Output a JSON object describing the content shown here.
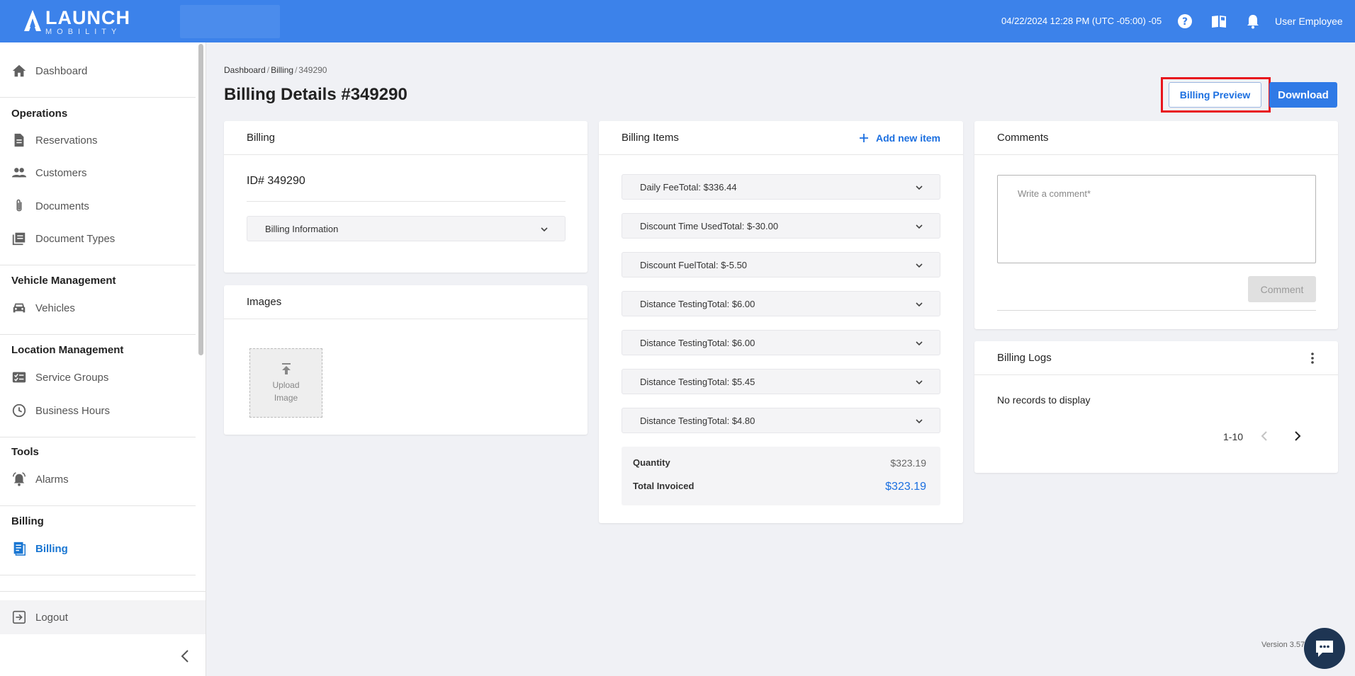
{
  "app": {
    "logo_main": "LAUNCH",
    "logo_sub": "MOBILITY",
    "datetime": "04/22/2024 12:28 PM (UTC -05:00) -05",
    "user": "User Employee"
  },
  "sidebar": {
    "dashboard": "Dashboard",
    "groups": {
      "operations": "Operations",
      "vehicle_management": "Vehicle Management",
      "location_management": "Location Management",
      "tools": "Tools",
      "billing": "Billing"
    },
    "items": {
      "reservations": "Reservations",
      "customers": "Customers",
      "documents": "Documents",
      "document_types": "Document Types",
      "vehicles": "Vehicles",
      "service_groups": "Service Groups",
      "business_hours": "Business Hours",
      "alarms": "Alarms",
      "billing": "Billing"
    },
    "logout": "Logout",
    "active_color": "#1976d2"
  },
  "breadcrumb": [
    "Dashboard",
    "Billing",
    "349290"
  ],
  "page": {
    "title": "Billing Details #349290",
    "preview_button": "Billing Preview",
    "download_button": "Download"
  },
  "billing_card": {
    "title": "Billing",
    "id_text": "ID# 349290",
    "info_label": "Billing Information"
  },
  "images_card": {
    "title": "Images",
    "upload_line1": "Upload",
    "upload_line2": "Image"
  },
  "billing_items": {
    "title": "Billing Items",
    "add_label": "Add new item",
    "items": [
      "Daily FeeTotal: $336.44",
      "Discount Time UsedTotal: $-30.00",
      "Discount FuelTotal: $-5.50",
      "Distance TestingTotal: $6.00",
      "Distance TestingTotal: $6.00",
      "Distance TestingTotal: $5.45",
      "Distance TestingTotal: $4.80"
    ],
    "quantity_label": "Quantity",
    "quantity_value": "$323.19",
    "total_label": "Total Invoiced",
    "total_value": "$323.19"
  },
  "comments": {
    "title": "Comments",
    "placeholder": "Write a comment*",
    "button": "Comment"
  },
  "billing_logs": {
    "title": "Billing Logs",
    "empty": "No records to display",
    "pagination": "1-10"
  },
  "footer": {
    "version": "Version 3.57"
  },
  "colors": {
    "topbar": "#3c82ea",
    "primary": "#2f7ae6",
    "highlight": "#e8141c"
  }
}
